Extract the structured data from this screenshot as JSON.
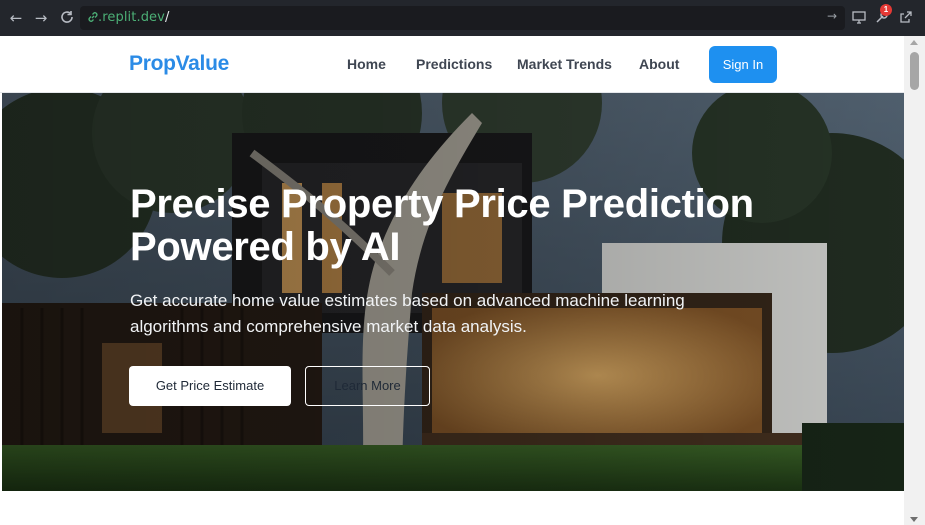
{
  "browser": {
    "url_domain": ".replit.dev",
    "url_path": "/",
    "notification_count": "1",
    "icons": [
      "back-icon",
      "forward-icon",
      "reload-icon",
      "link-icon",
      "go-arrow-icon",
      "screen-icon",
      "wrench-icon",
      "external-link-icon"
    ]
  },
  "header": {
    "logo": "PropValue",
    "nav": [
      "Home",
      "Predictions",
      "Market Trends",
      "About"
    ],
    "signin_label": "Sign In"
  },
  "hero": {
    "title": "Precise Property Price Prediction Powered by AI",
    "subtitle": "Get accurate home value estimates based on advanced machine learning algorithms and comprehensive market data analysis.",
    "primary_button": "Get Price Estimate",
    "secondary_button": "Learn More"
  },
  "colors": {
    "brand": "#2b8be6",
    "signin_bg": "#1e90f0",
    "chrome_bg": "#23262c"
  }
}
